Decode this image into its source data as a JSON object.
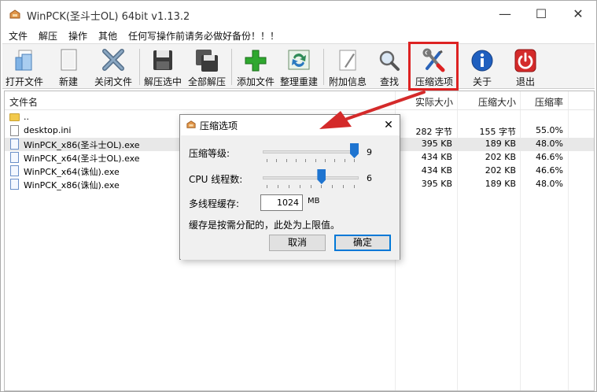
{
  "window": {
    "title": "WinPCK(圣斗士OL) 64bit v1.13.2",
    "minimize": "—",
    "maximize": "☐",
    "close": "✕"
  },
  "menu": [
    "文件",
    "解压",
    "操作",
    "其他",
    "任何写操作前请务必做好备份！！！"
  ],
  "toolbar": [
    {
      "label": "打开文件",
      "icon": "open-file-icon"
    },
    {
      "label": "新建",
      "icon": "new-file-icon"
    },
    {
      "label": "关闭文件",
      "icon": "close-file-icon"
    },
    {
      "label": "解压选中",
      "icon": "extract-selected-icon"
    },
    {
      "label": "全部解压",
      "icon": "extract-all-icon"
    },
    {
      "label": "添加文件",
      "icon": "add-file-icon"
    },
    {
      "label": "整理重建",
      "icon": "rebuild-icon"
    },
    {
      "label": "附加信息",
      "icon": "info-pen-icon"
    },
    {
      "label": "查找",
      "icon": "search-icon"
    },
    {
      "label": "压缩选项",
      "icon": "tools-icon"
    },
    {
      "label": "关于",
      "icon": "about-icon"
    },
    {
      "label": "退出",
      "icon": "power-icon"
    }
  ],
  "list": {
    "headers": [
      "文件名",
      "实际大小",
      "压缩大小",
      "压缩率"
    ],
    "parent": "..",
    "rows": [
      {
        "name": "desktop.ini",
        "real": "282 字节",
        "comp": "155 字节",
        "ratio": "55.0%",
        "type": "ini"
      },
      {
        "name": "WinPCK_x86(圣斗士OL).exe",
        "real": "395 KB",
        "comp": "189 KB",
        "ratio": "48.0%",
        "type": "exe"
      },
      {
        "name": "WinPCK_x64(圣斗士OL).exe",
        "real": "434 KB",
        "comp": "202 KB",
        "ratio": "46.6%",
        "type": "exe"
      },
      {
        "name": "WinPCK_x64(诛仙).exe",
        "real": "434 KB",
        "comp": "202 KB",
        "ratio": "46.6%",
        "type": "exe"
      },
      {
        "name": "WinPCK_x86(诛仙).exe",
        "real": "395 KB",
        "comp": "189 KB",
        "ratio": "48.0%",
        "type": "exe"
      }
    ]
  },
  "dialog": {
    "title": "压缩选项",
    "close": "✕",
    "level_label": "压缩等级:",
    "level_value": "9",
    "level_fraction": 1.0,
    "threads_label": "CPU 线程数:",
    "threads_value": "6",
    "threads_fraction": 0.625,
    "cache_label": "多线程缓存:",
    "cache_value": "1024",
    "cache_unit": "MB",
    "note": "缓存是按需分配的，此处为上限值。",
    "cancel": "取消",
    "ok": "确定"
  },
  "colors": {
    "highlight": "#d22222",
    "arrow": "#d42a2a",
    "accent": "#0078d7"
  }
}
